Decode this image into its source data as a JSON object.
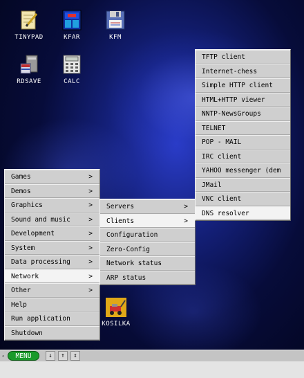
{
  "desktop": {
    "icons": [
      {
        "label": "TINYPAD",
        "icon": "notepad-icon"
      },
      {
        "label": "KFAR",
        "icon": "file-manager-icon"
      },
      {
        "label": "KFM",
        "icon": "floppy-icon"
      },
      {
        "label": "RDSAVE",
        "icon": "ramdisk-save-icon"
      },
      {
        "label": "CALC",
        "icon": "calculator-icon"
      },
      {
        "label": "KOSILKA",
        "icon": "lawnmower-icon"
      }
    ]
  },
  "main_menu": {
    "items": [
      {
        "label": "Games",
        "arrow": ">"
      },
      {
        "label": "Demos",
        "arrow": ">"
      },
      {
        "label": "Graphics",
        "arrow": ">"
      },
      {
        "label": "Sound and music",
        "arrow": ">"
      },
      {
        "label": "Development",
        "arrow": ">"
      },
      {
        "label": "System",
        "arrow": ">"
      },
      {
        "label": "Data processing",
        "arrow": ">"
      },
      {
        "label": "Network",
        "arrow": ">"
      },
      {
        "label": "Other",
        "arrow": ">"
      },
      {
        "label": "Help",
        "arrow": ""
      },
      {
        "label": "Run application",
        "arrow": ""
      },
      {
        "label": "Shutdown",
        "arrow": ""
      }
    ]
  },
  "network_menu": {
    "items": [
      {
        "label": "Servers",
        "arrow": ">"
      },
      {
        "label": "Clients",
        "arrow": ">"
      },
      {
        "label": "Configuration",
        "arrow": ""
      },
      {
        "label": "Zero-Config",
        "arrow": ""
      },
      {
        "label": "Network status",
        "arrow": ""
      },
      {
        "label": "ARP status",
        "arrow": ""
      }
    ]
  },
  "clients_menu": {
    "items": [
      {
        "label": "TFTP client"
      },
      {
        "label": "Internet-chess"
      },
      {
        "label": "Simple HTTP client"
      },
      {
        "label": "HTML+HTTP viewer"
      },
      {
        "label": "NNTP-NewsGroups"
      },
      {
        "label": "TELNET"
      },
      {
        "label": "POP - MAIL"
      },
      {
        "label": "IRC client"
      },
      {
        "label": "YAHOO messenger (dem"
      },
      {
        "label": "JMail"
      },
      {
        "label": "VNC client"
      },
      {
        "label": "DNS resolver"
      }
    ]
  },
  "taskbar": {
    "left_glyph": "◂",
    "menu_label": "MENU",
    "buttons": [
      "↓",
      "↑",
      "⇕"
    ]
  },
  "colors": {
    "menu_button": "#1a9a2a",
    "menu_bg": "#cfcfcf",
    "highlight": "#f3f3f3"
  }
}
